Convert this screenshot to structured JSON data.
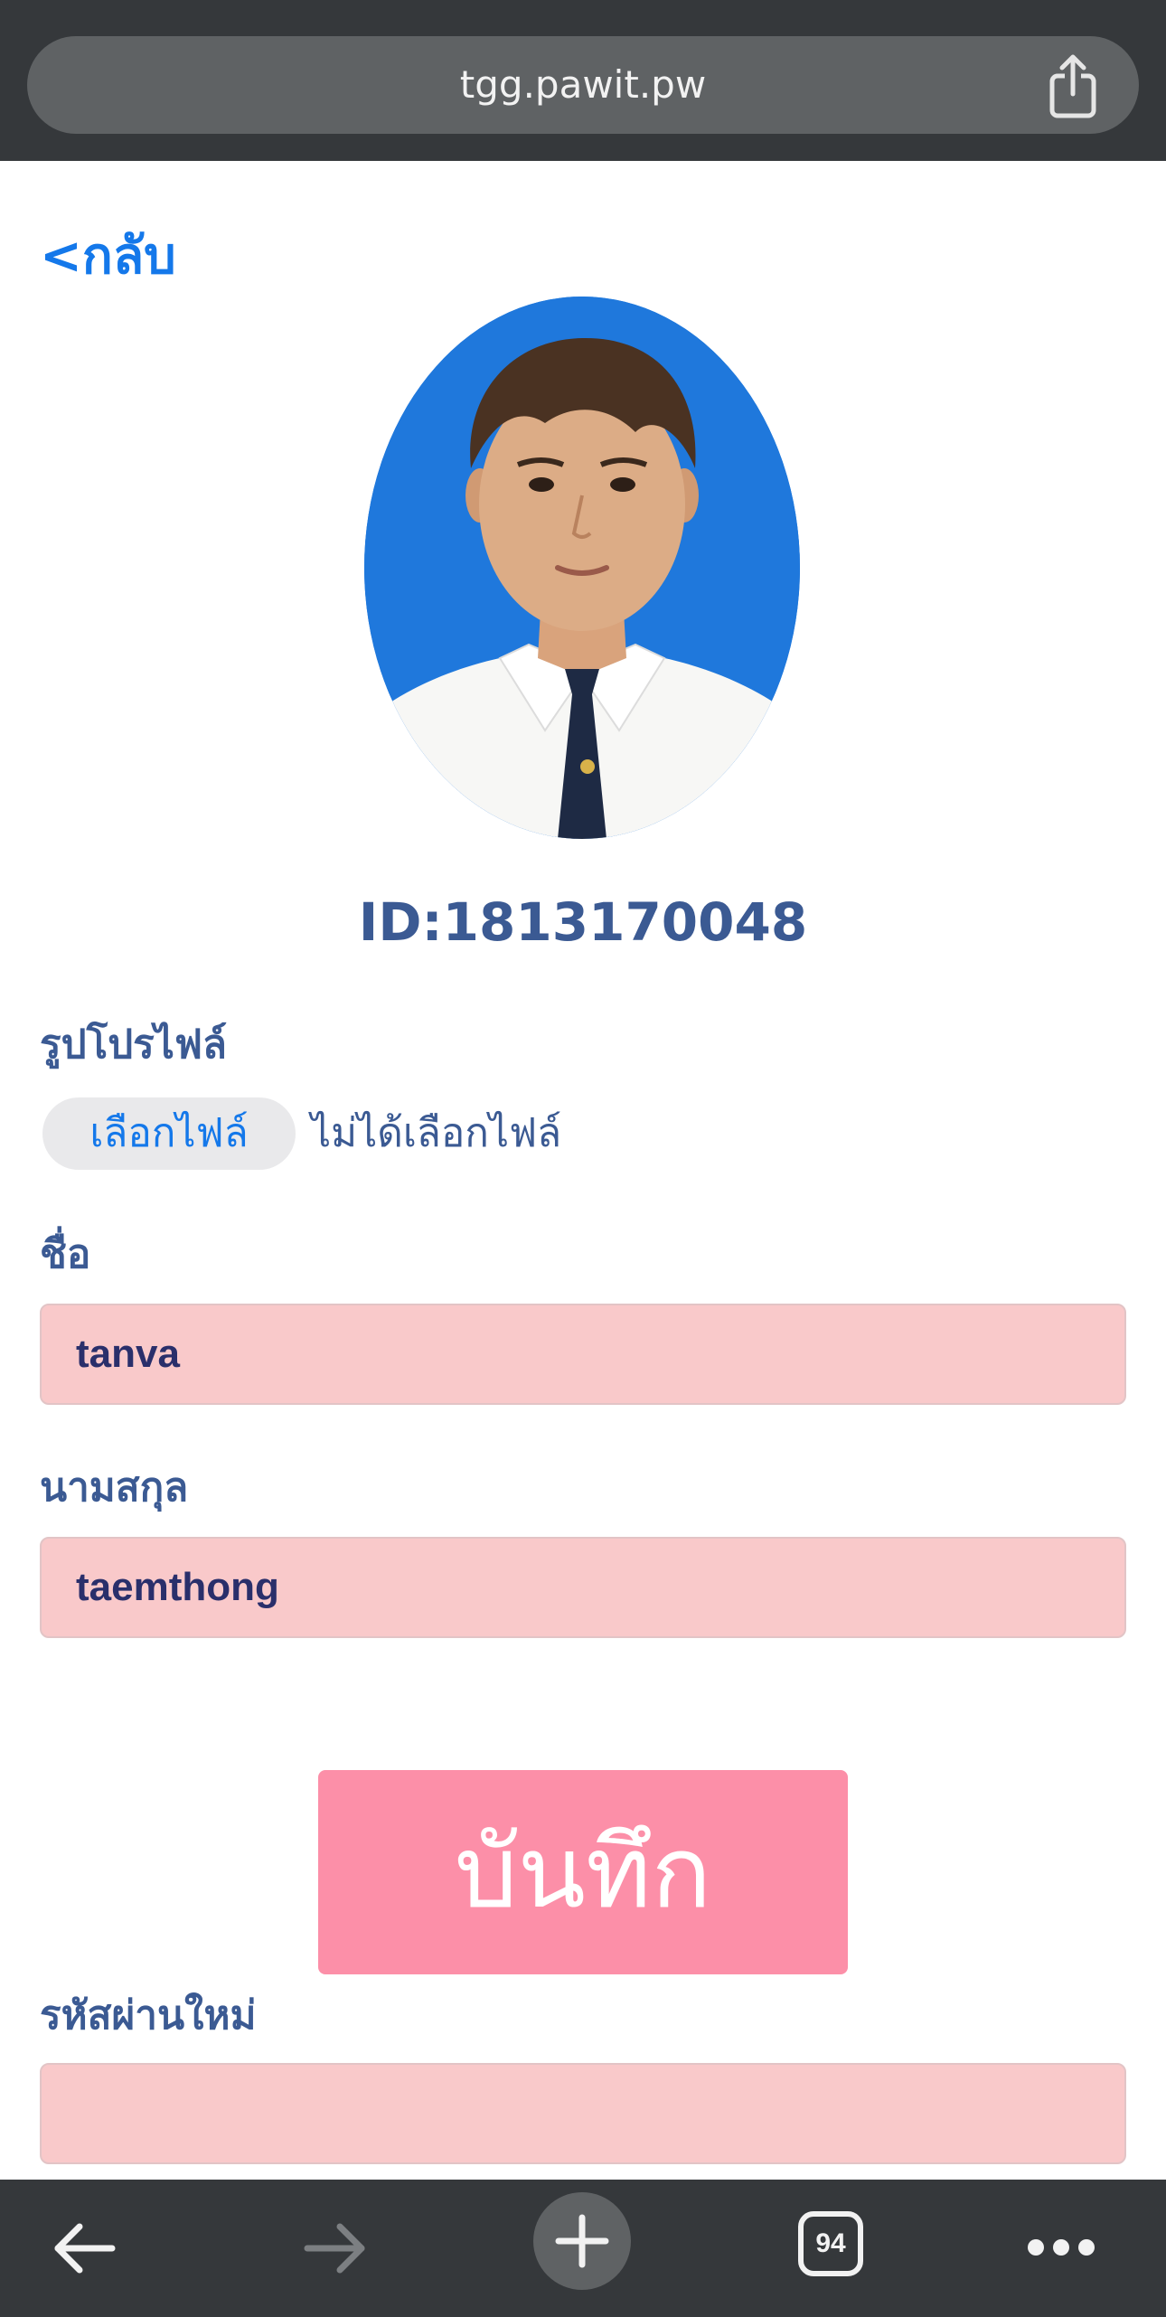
{
  "browser": {
    "url": "tgg.pawit.pw",
    "tab_count": "94"
  },
  "page": {
    "back_label": "<กลับ",
    "student_id": "ID:1813170048",
    "profile_photo_label": "รูปโปรไฟล์",
    "file_button_label": "เลือกไฟล์",
    "file_status": "ไม่ได้เลือกไฟล์",
    "first_name_label": "ชื่อ",
    "first_name_value": "tanva",
    "last_name_label": "นามสกุล",
    "last_name_value": "taemthong",
    "save_label": "บันทึก",
    "new_password_label": "รหัสผ่านใหม่",
    "new_password_value": ""
  },
  "colors": {
    "link": "#1478ea",
    "label": "#3b5a93",
    "field_bg": "#f9c9ca",
    "save_button": "#fc8fa8",
    "browser_chrome": "#35383b"
  },
  "icons": {
    "share": "share-icon",
    "back": "arrow-left-icon",
    "forward": "arrow-right-icon",
    "new_tab": "plus-icon",
    "tabs": "tabs-icon",
    "more": "more-icon",
    "photo": "profile-photo"
  }
}
